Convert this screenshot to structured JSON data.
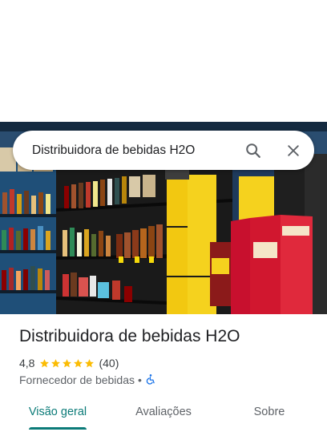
{
  "search": {
    "query": "Distribuidora de bebidas H2O"
  },
  "place": {
    "name": "Distribuidora de bebidas H2O",
    "rating": "4,8",
    "stars": 5,
    "review_count": "(40)",
    "category": "Fornecedor de bebidas",
    "separator": "•",
    "accessibility_icon": "wheelchair-icon"
  },
  "tabs": [
    {
      "label": "Visão geral",
      "active": true
    },
    {
      "label": "Avaliações",
      "active": false
    },
    {
      "label": "Sobre",
      "active": false
    }
  ],
  "colors": {
    "accent": "#0b7b78",
    "star": "#fbbc04",
    "accessibility": "#1a73e8"
  }
}
